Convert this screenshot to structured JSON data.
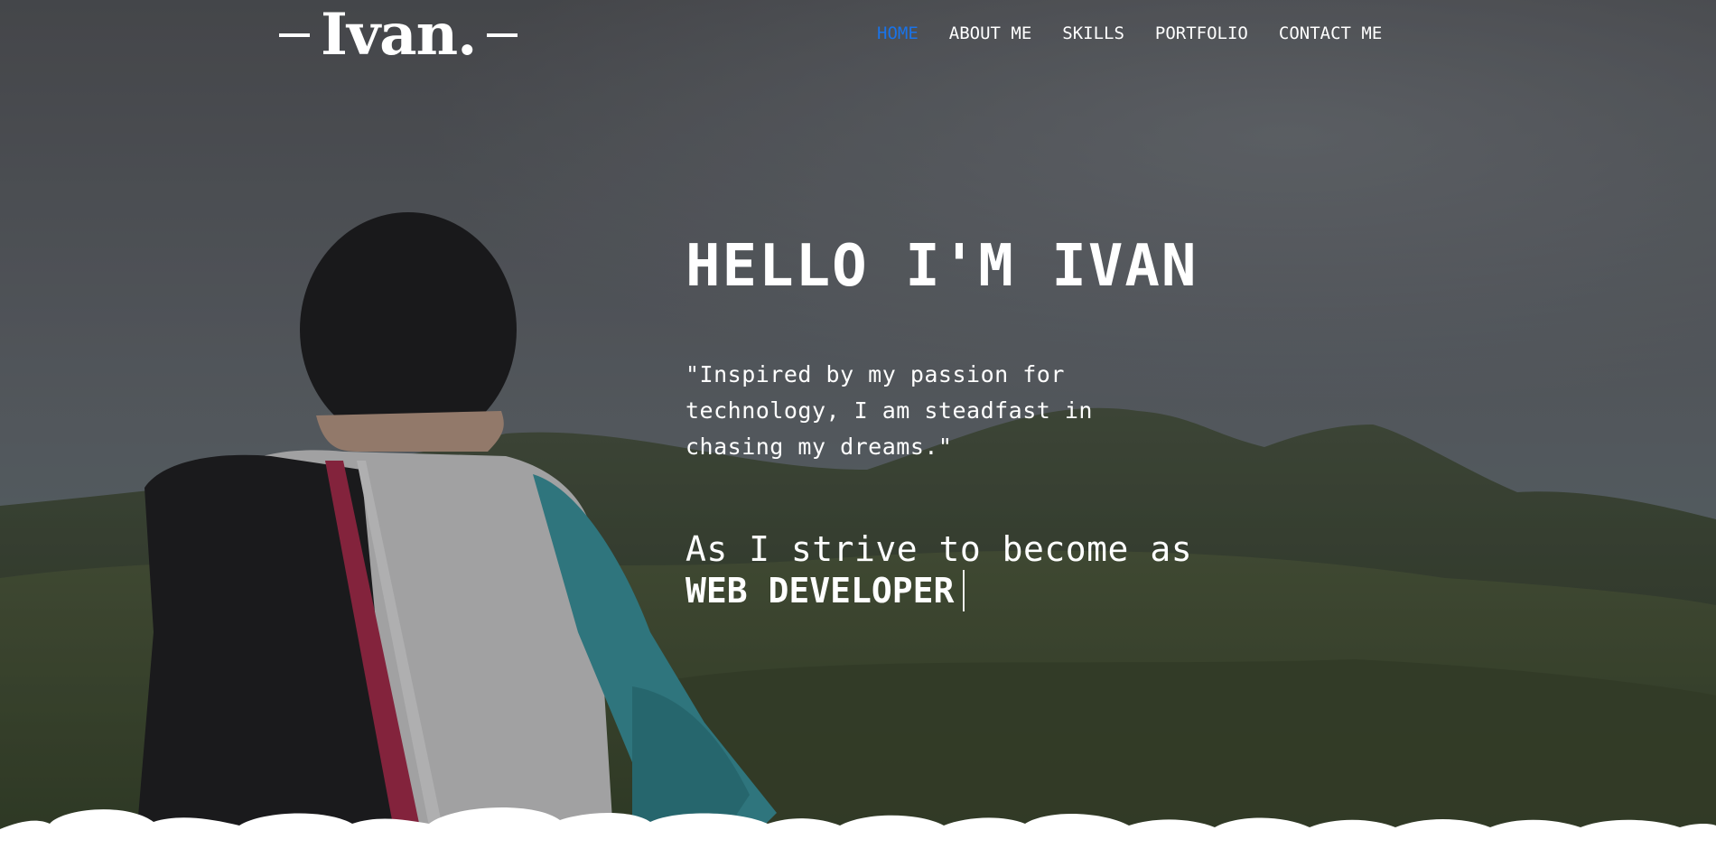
{
  "brand": {
    "logo_text": "Ivan."
  },
  "nav": {
    "items": [
      {
        "label": "HOME",
        "active": true
      },
      {
        "label": "ABOUT ME",
        "active": false
      },
      {
        "label": "SKILLS",
        "active": false
      },
      {
        "label": "PORTFOLIO",
        "active": false
      },
      {
        "label": "CONTACT ME",
        "active": false
      }
    ]
  },
  "hero": {
    "title": "HELLO I'M IVAN",
    "quote": "\"Inspired by my passion for technology, I am steadfast in chasing my dreams.\"",
    "strive_text": "As I strive to become as",
    "role": "WEB DEVELOPER"
  },
  "colors": {
    "accent": "#1a73e8",
    "text": "#ffffff"
  }
}
